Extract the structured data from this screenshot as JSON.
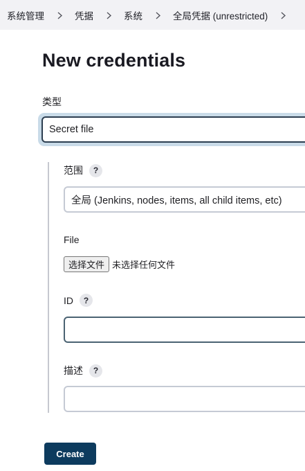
{
  "breadcrumb": {
    "items": [
      {
        "label": "系统管理"
      },
      {
        "label": "凭据"
      },
      {
        "label": "系统"
      },
      {
        "label": "全局凭据 (unrestricted)"
      }
    ]
  },
  "page": {
    "title": "New credentials"
  },
  "form": {
    "type_label": "类型",
    "type_value": "Secret file",
    "scope_label": "范围",
    "scope_value": "全局 (Jenkins, nodes, items, all child items, etc)",
    "file_label": "File",
    "file_button_label": "选择文件",
    "file_status": "未选择任何文件",
    "id_label": "ID",
    "id_value": "",
    "description_label": "描述",
    "description_value": "",
    "help_glyph": "?",
    "create_label": "Create"
  },
  "icons": {
    "breadcrumb_separator": "chevron-right-icon",
    "help": "help-icon"
  }
}
